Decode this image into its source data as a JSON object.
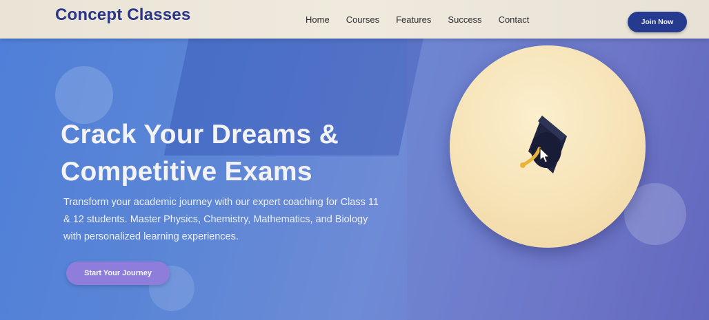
{
  "header": {
    "logo": "Concept Classes",
    "nav": [
      "Home",
      "Courses",
      "Features",
      "Success",
      "Contact"
    ],
    "join_label": "Join Now"
  },
  "hero": {
    "title_line1": "Crack Your Dreams &",
    "title_line2": "Competitive Exams",
    "description": "Transform your academic journey with our expert coaching for Class 11 & 12 students. Master Physics, Chemistry, Mathematics, and Biology with personalized learning experiences.",
    "cta_label": "Start Your Journey",
    "illustration_icon": "graduation-cap-icon"
  },
  "colors": {
    "brand": "#2a3585",
    "join_button": "#263a8f",
    "hero_gradient_start": "#4f7fd8",
    "hero_gradient_end": "#5e63bb",
    "cta": "#8e7ddb",
    "circle": "#f6e2b6"
  }
}
